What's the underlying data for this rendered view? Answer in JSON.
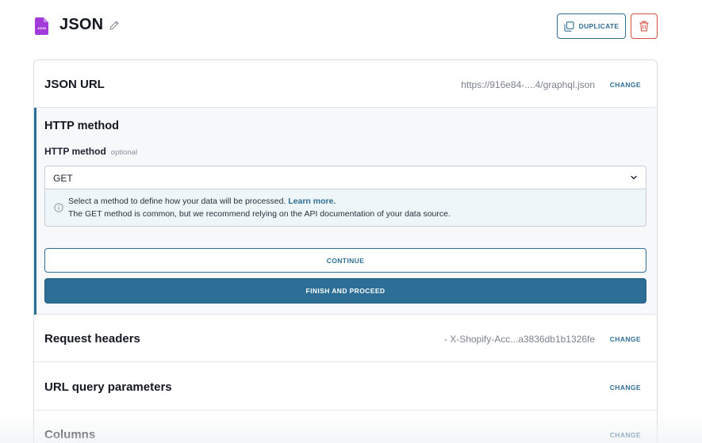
{
  "header": {
    "title": "JSON",
    "file_icon_name": "json-file-icon",
    "file_icon_text": "JSON",
    "duplicate_label": "DUPLICATE"
  },
  "sections": {
    "json_url": {
      "title": "JSON URL",
      "value": "https://916e84-....4/graphql.json",
      "change_label": "CHANGE"
    },
    "http_method": {
      "title": "HTTP method",
      "field_label": "HTTP method",
      "optional_label": "optional",
      "selected": "GET",
      "info_text": "Select a method to define how your data will be processed.",
      "info_link": "Learn more.",
      "info_line2": "The GET method is common, but we recommend relying on the API documentation of your data source.",
      "continue_label": "CONTINUE",
      "finish_label": "FINISH AND PROCEED"
    },
    "request_headers": {
      "title": "Request headers",
      "value": "- X-Shopify-Acc...a3836db1b1326fe",
      "change_label": "CHANGE"
    },
    "url_query": {
      "title": "URL query parameters",
      "change_label": "CHANGE"
    },
    "columns": {
      "title": "Columns",
      "change_label": "CHANGE"
    }
  },
  "colors": {
    "accent": "#2f6f94",
    "danger": "#d05140",
    "file_icon": "#a23ad9"
  }
}
